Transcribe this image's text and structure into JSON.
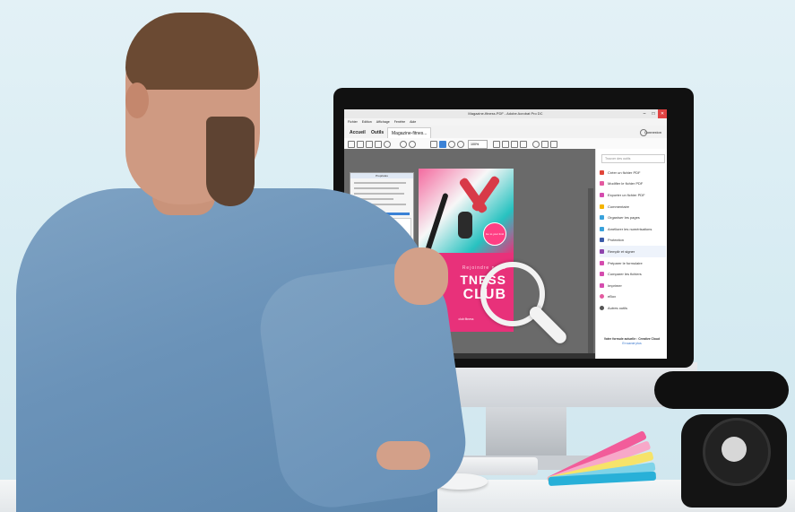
{
  "app": {
    "window_title": "Magazine-fitness.PDF - Adobe Acrobat Pro DC",
    "menu_items": [
      "Fichier",
      "Edition",
      "Affichage",
      "Fenêtre",
      "Aide"
    ],
    "tabs": [
      {
        "label": "Accueil"
      },
      {
        "label": "Outils"
      },
      {
        "label": "Magazine-fitnes..."
      }
    ],
    "signin_label": "Connexion",
    "zoom_value": "100%",
    "search_placeholder": "Trouver des outils",
    "tools": [
      {
        "label": "Créer un fichier PDF",
        "color": "#e0453a"
      },
      {
        "label": "Modifier le fichier PDF",
        "color": "#e45aa0"
      },
      {
        "label": "Exporter un fichier PDF",
        "color": "#d54cae"
      },
      {
        "label": "Commentaire",
        "color": "#f4b400"
      },
      {
        "label": "Organiser les pages",
        "color": "#39a2db"
      },
      {
        "label": "Améliorer les numérisations",
        "color": "#39a2db"
      },
      {
        "label": "Protection",
        "color": "#3b5ba9"
      },
      {
        "label": "Remplir et signer",
        "color": "#8e44ad"
      },
      {
        "label": "Préparer le formulaire",
        "color": "#d54cae"
      },
      {
        "label": "Comparer les fichiers",
        "color": "#d54cae"
      },
      {
        "label": "Imprimer",
        "color": "#d54cae"
      },
      {
        "label": "eBox",
        "color": "#e45aa0"
      },
      {
        "label": "Autres outils",
        "color": "#555555"
      }
    ],
    "promo_text": "Votre formule actuelle : Creative Cloud",
    "promo_link": "En savoir plus",
    "status_text": "215,9 x 279,4 mm",
    "dialog_title": "Propriétés"
  },
  "poster": {
    "stamp_text": "Go to your limit",
    "line1": "Rejoindre notre",
    "line2": "TNESS",
    "line3": "CLUB",
    "logo_text": "club fitness"
  },
  "colors": {
    "poster_pink": "#e8317a",
    "swatches": [
      "#f25c9a",
      "#f7a8c9",
      "#f6e36a",
      "#7fd3e8",
      "#28b0d8",
      "#b87bd1"
    ]
  }
}
